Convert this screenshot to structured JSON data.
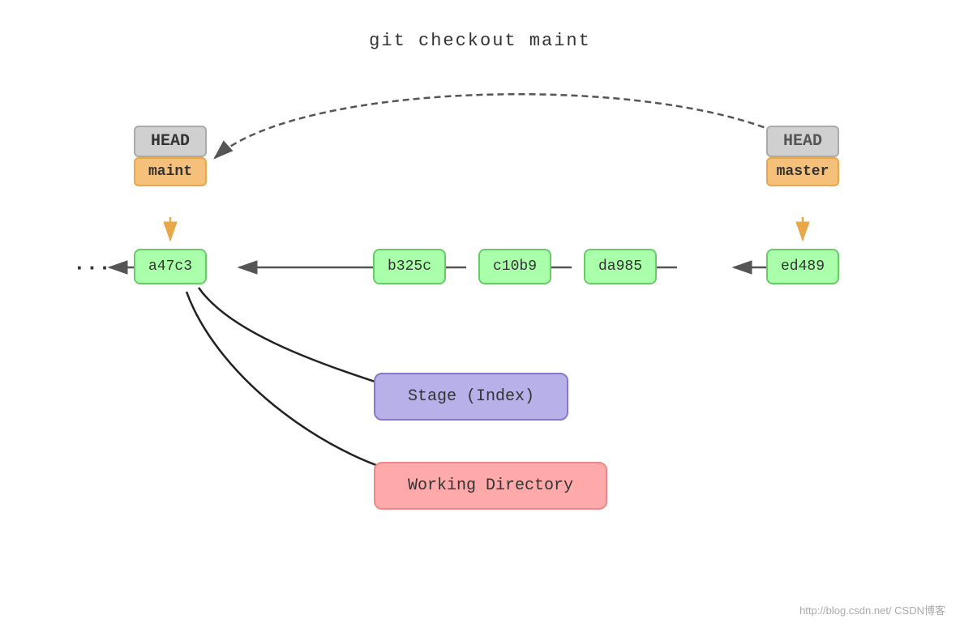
{
  "title": "git checkout maint",
  "head_left": {
    "label": "HEAD",
    "branch": "maint",
    "active": true
  },
  "head_right": {
    "label": "HEAD",
    "branch": "master",
    "active": false
  },
  "commits": [
    "a47c3",
    "b325c",
    "c10b9",
    "da985",
    "ed489"
  ],
  "stage": "Stage (Index)",
  "working": "Working Directory",
  "ellipsis": "···",
  "watermark": "http://blog.csdn.net/  CSDN博客"
}
